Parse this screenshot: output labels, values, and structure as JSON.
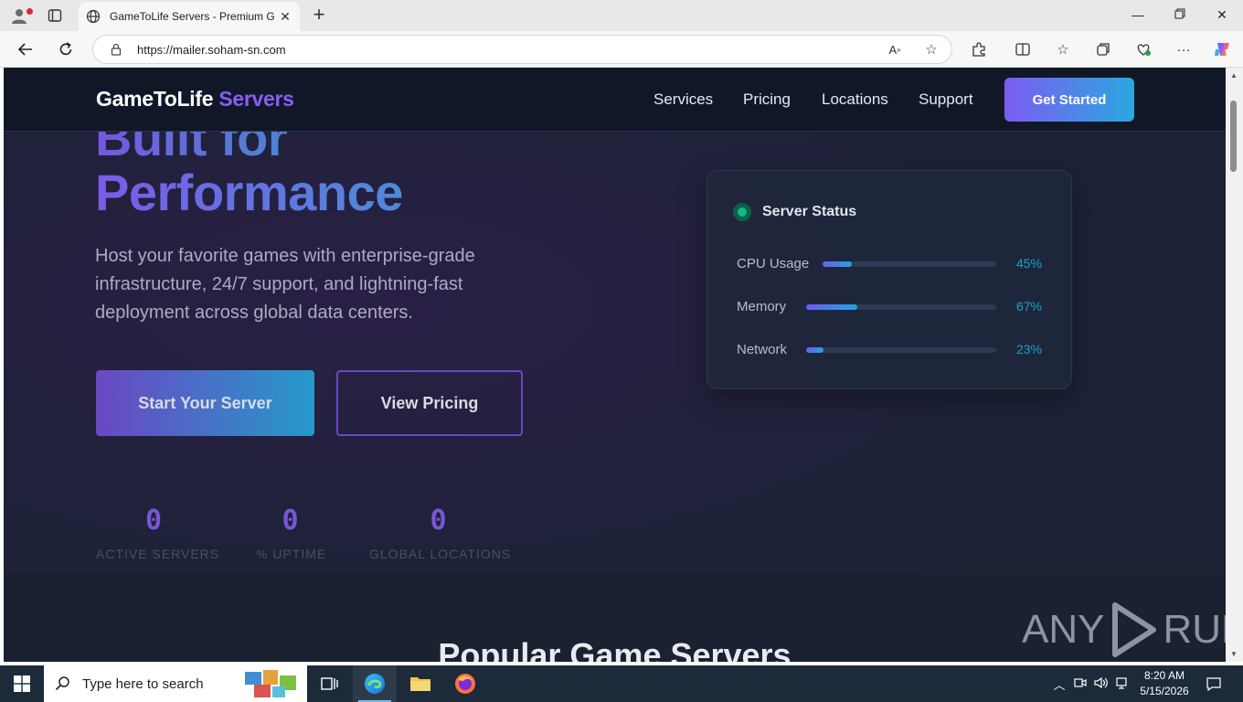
{
  "browser": {
    "tab_title": "GameToLife Servers - Premium Game Server Hosting",
    "url": "https://mailer.soham-sn.com",
    "new_tab_icon": "plus-icon",
    "accent_color": "#0078d4"
  },
  "site": {
    "brand_main": "GameToLife",
    "brand_accent": "Servers",
    "nav": [
      "Services",
      "Pricing",
      "Locations",
      "Support"
    ],
    "cta": "Get Started"
  },
  "hero": {
    "title_line1": "Built for",
    "title_line2": "Performance",
    "subtitle": "Host your favorite games with enterprise-grade infrastructure, 24/7 support, and lightning-fast deployment across global data centers.",
    "primary_button": "Start Your Server",
    "secondary_button": "View Pricing"
  },
  "stats": [
    {
      "value": "0",
      "label": "ACTIVE SERVERS"
    },
    {
      "value": "0",
      "label": "% UPTIME"
    },
    {
      "value": "0",
      "label": "GLOBAL LOCATIONS"
    }
  ],
  "status_card": {
    "title": "Server Status",
    "status_color": "#10b981",
    "metrics": [
      {
        "label": "CPU Usage",
        "value_text": "45%",
        "fraction": 0.17
      },
      {
        "label": "Memory",
        "value_text": "67%",
        "fraction": 0.27
      },
      {
        "label": "Network",
        "value_text": "23%",
        "fraction": 0.09
      }
    ]
  },
  "section": {
    "title": "Popular Game Servers"
  },
  "watermark": {
    "text_left": "ANY",
    "text_right": "RUN"
  },
  "taskbar": {
    "search_placeholder": "Type here to search",
    "time": "8:20 AM",
    "date": "5/15/2026"
  }
}
